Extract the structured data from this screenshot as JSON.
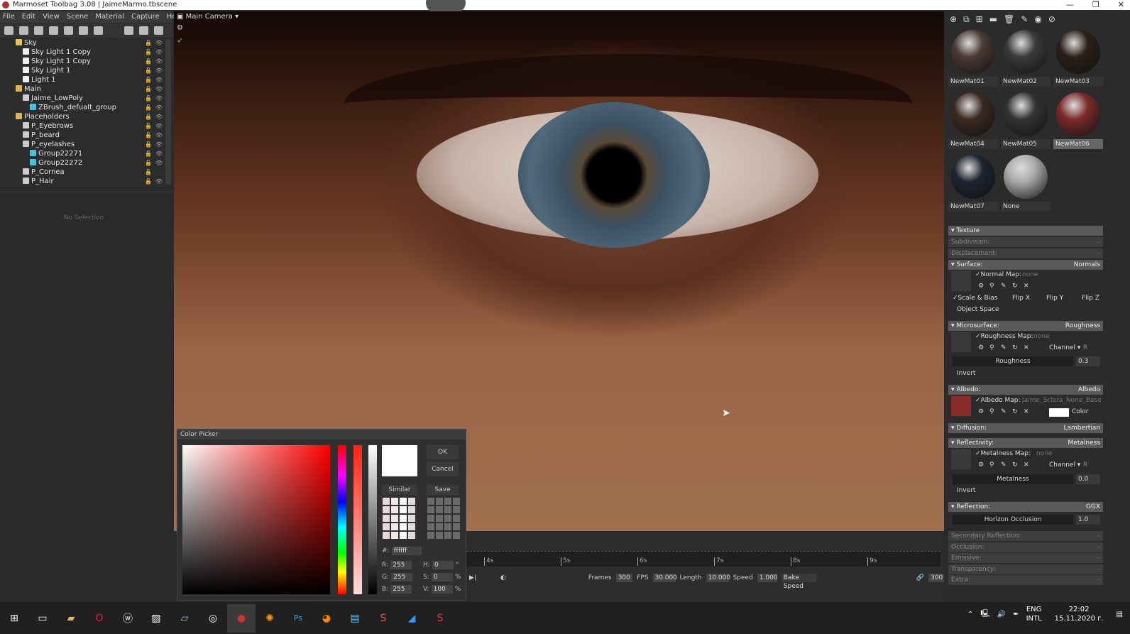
{
  "window": {
    "title": "Marmoset Toolbag 3.08 | JaimeMarmo.tbscene",
    "controls": [
      "—",
      "❐",
      "✕"
    ]
  },
  "menu": [
    "File",
    "Edit",
    "View",
    "Scene",
    "Material",
    "Capture",
    "Help"
  ],
  "scene_toolbar_icons": [
    "mesh-icon",
    "light-icon",
    "camera-icon",
    "shadow-catcher-icon",
    "fog-icon",
    "skin-icon",
    "turntable-icon",
    "folder-icon",
    "duplicate-icon",
    "delete-icon"
  ],
  "tree": [
    {
      "label": "Sky",
      "depth": 0,
      "type": "sky"
    },
    {
      "label": "Sky Light 1 Copy",
      "depth": 1,
      "type": "light"
    },
    {
      "label": "Sky Light 1 Copy",
      "depth": 1,
      "type": "light"
    },
    {
      "label": "Sky Light 1",
      "depth": 1,
      "type": "light"
    },
    {
      "label": "Light 1",
      "depth": 1,
      "type": "light"
    },
    {
      "label": "Main",
      "depth": 0,
      "type": "folder"
    },
    {
      "label": "Jaime_LowPoly",
      "depth": 1,
      "type": "object"
    },
    {
      "label": "ZBrush_defualt_group",
      "depth": 2,
      "type": "mesh"
    },
    {
      "label": "Placeholders",
      "depth": 0,
      "type": "folder"
    },
    {
      "label": "P_Eyebrows",
      "depth": 1,
      "type": "object"
    },
    {
      "label": "P_beard",
      "depth": 1,
      "type": "object"
    },
    {
      "label": "P_eyelashes",
      "depth": 1,
      "type": "object"
    },
    {
      "label": "Group22271",
      "depth": 2,
      "type": "mesh"
    },
    {
      "label": "Group22272",
      "depth": 2,
      "type": "mesh"
    },
    {
      "label": "P_Cornea",
      "depth": 1,
      "type": "object"
    },
    {
      "label": "P_Hair",
      "depth": 1,
      "type": "object"
    }
  ],
  "no_selection": "No Selection",
  "viewport": {
    "camera": "Main Camera ▾"
  },
  "color_picker": {
    "title": "Color Picker",
    "ok": "OK",
    "cancel": "Cancel",
    "similar": "Similar",
    "save": "Save",
    "hex_label": "#:",
    "hex": "ffffff",
    "r_label": "R:",
    "r": "255",
    "g_label": "G:",
    "g": "255",
    "b_label": "B:",
    "b": "255",
    "h_label": "H:",
    "h": "0",
    "h_unit": "°",
    "s_label": "S:",
    "s": "0",
    "s_unit": "%",
    "v_label": "V:",
    "v": "100",
    "v_unit": "%"
  },
  "timeline": {
    "ticks": [
      "4s",
      "5s",
      "6s",
      "7s",
      "8s",
      "9s"
    ],
    "frames_label": "Frames",
    "frames": "300",
    "fps_label": "FPS",
    "fps": "30.000",
    "length_label": "Length",
    "length": "10.000",
    "speed_label": "Speed",
    "speed": "1.000",
    "bake_speed": "Bake Speed",
    "end_frame": "300"
  },
  "materials": [
    {
      "name": "NewMat01",
      "color": "#4a3a34"
    },
    {
      "name": "NewMat02",
      "color": "#3a3a3a"
    },
    {
      "name": "NewMat03",
      "color": "#2a2018"
    },
    {
      "name": "NewMat04",
      "color": "#3a2a20"
    },
    {
      "name": "NewMat05",
      "color": "#333"
    },
    {
      "name": "NewMat06",
      "color": "#7a2a2a",
      "selected": true
    },
    {
      "name": "NewMat07",
      "color": "#1e2430"
    },
    {
      "name": "None",
      "color": "#aaa"
    }
  ],
  "props": {
    "texture": "Texture",
    "subdivision": "Subdivision:",
    "displacement": "Displacement:",
    "dash": "-",
    "surface": "Surface:",
    "surface_mode": "Normals",
    "normal_map": "✓Normal Map:",
    "none": "none",
    "scale_bias": "✓Scale & Bias",
    "flip_x": "Flip X",
    "flip_y": "Flip Y",
    "flip_z": "Flip Z",
    "object_space": "Object Space",
    "microsurface": "Microsurface:",
    "micro_mode": "Roughness",
    "roughness_map": "✓Roughness Map:",
    "channel": "Channel ▾",
    "channel_r": "R",
    "roughness": "Roughness",
    "roughness_val": "0.3",
    "invert": "Invert",
    "albedo": "Albedo:",
    "albedo_mode": "Albedo",
    "albedo_map": "✓Albedo Map:",
    "albedo_file": "Jaime_Sclera_None_BaseColor",
    "color": "Color",
    "diffusion": "Diffusion:",
    "diffusion_mode": "Lambertian",
    "reflectivity": "Reflectivity:",
    "refl_mode": "Metalness",
    "metalness_map": "✓Metalness Map:",
    "metalness": "Metalness",
    "metalness_val": "0.0",
    "reflection": "Reflection:",
    "reflection_mode": "GGX",
    "horizon": "Horizon Occlusion",
    "horizon_val": "1.0",
    "secondary": "Secondary Reflection:",
    "occlusion": "Occlusion:",
    "emissive": "Emissive:",
    "transparency": "Transparency:",
    "extra": "Extra:"
  },
  "tray": {
    "lang1": "ENG",
    "lang2": "INTL",
    "time": "22:02",
    "date": "15.11.2020 г."
  }
}
